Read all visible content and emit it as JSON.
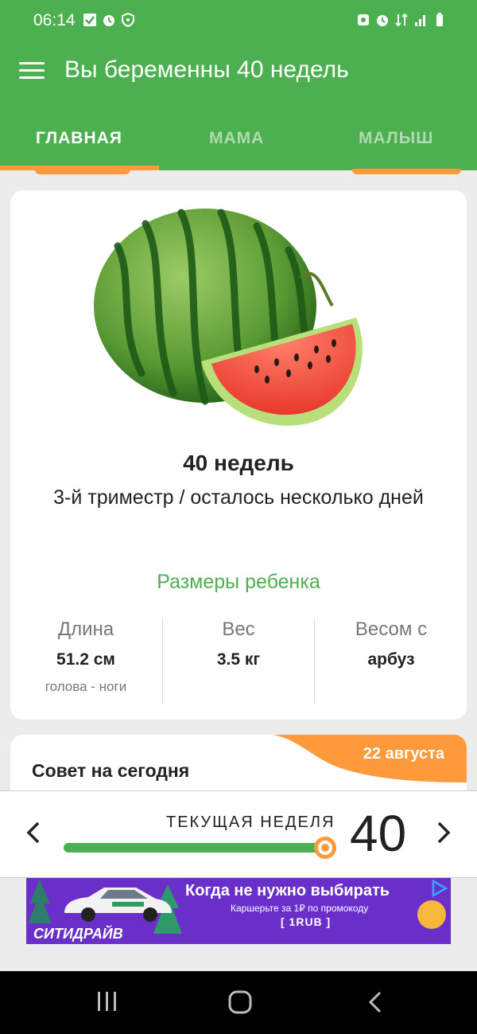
{
  "status_bar": {
    "time": "06:14",
    "left_icons": [
      "check-icon",
      "alarm-icon",
      "shield-icon"
    ],
    "right_icons": [
      "alarm-icon",
      "alarm-icon",
      "data-icon",
      "signal-icon",
      "battery-icon"
    ]
  },
  "app_bar": {
    "title": "Вы беременны 40 недель",
    "menu_icon": "hamburger-menu-icon"
  },
  "tabs": [
    {
      "label": "ГЛАВНАЯ",
      "active": true
    },
    {
      "label": "МАМА",
      "active": false
    },
    {
      "label": "МАЛЫШ",
      "active": false
    }
  ],
  "week_card": {
    "image": "watermelon",
    "week_title": "40 недель",
    "trimester_text": "3-й триместр / осталось несколько дней",
    "sizes_title": "Размеры ребенка",
    "columns": [
      {
        "label": "Длина",
        "value": "51.2 см",
        "sub": "голова - ноги"
      },
      {
        "label": "Вес",
        "value": "3.5 кг",
        "sub": ""
      },
      {
        "label": "Весом с",
        "value": "арбуз",
        "sub": ""
      }
    ]
  },
  "advice": {
    "title": "Совет на сегодня",
    "date": "22 августа"
  },
  "week_selector": {
    "label": "ТЕКУЩАЯ НЕДЕЛЯ",
    "week": "40",
    "progress": 1.0,
    "prev_icon": "chevron-left-icon",
    "next_icon": "chevron-right-icon"
  },
  "ad": {
    "brand": "СИТИДРАЙВ",
    "headline": "Когда не нужно выбирать",
    "subline": "Каршерьте за 1₽ по промокоду",
    "code": "[ 1RUB ]"
  },
  "colors": {
    "primary_green": "#4caf50",
    "accent_orange": "#ff9a3c",
    "ad_purple": "#6a2fc9"
  },
  "nav_bar": {
    "icons": [
      "recents-icon",
      "home-icon",
      "back-icon"
    ]
  }
}
